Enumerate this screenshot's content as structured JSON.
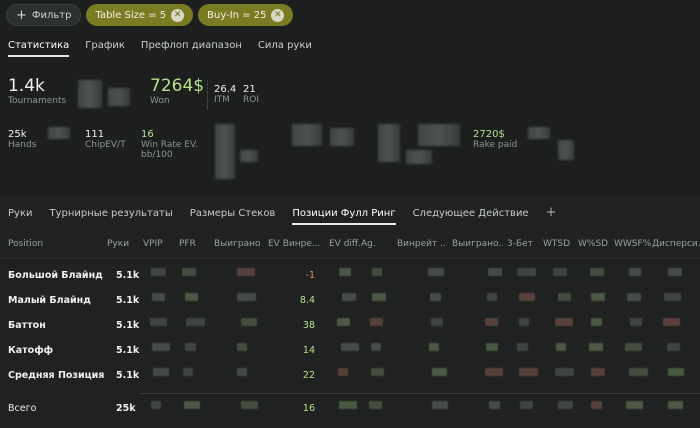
{
  "filters": {
    "filter_label": "Фильтр",
    "chips": [
      {
        "label": "Table Size = 5"
      },
      {
        "label": "Buy-In = 25"
      }
    ]
  },
  "main_tabs": [
    "Статистика",
    "График",
    "Префлоп диапазон",
    "Сила руки"
  ],
  "stats": {
    "tournaments": {
      "value": "1.4k",
      "label": "Tournaments"
    },
    "won": {
      "value": "7264$",
      "label": "Won"
    },
    "itm": {
      "value": "26.4",
      "label": "ITM"
    },
    "roi": {
      "value": "21",
      "label": "ROI"
    },
    "hands": {
      "value": "25k",
      "label": "Hands"
    },
    "chipev": {
      "value": "111",
      "label": "ChipEV/T"
    },
    "winrate": {
      "value": "16",
      "label": "Win Rate EV.",
      "label2": "bb/100"
    },
    "rake": {
      "value": "2720$",
      "label": "Rake paid"
    }
  },
  "sub_tabs": [
    "Руки",
    "Турнирные результаты",
    "Размеры Стеков",
    "Позиции Фулл Ринг",
    "Следующее Действие"
  ],
  "table": {
    "headers": [
      "Position",
      "Руки",
      "VPIP",
      "PFR",
      "Выиграно",
      "EV Винре...",
      "EV diff.",
      "Ag.",
      "Винрейт ...",
      "Выиграно...",
      "3-Бет",
      "WTSD",
      "W%SD",
      "WWSF%",
      "Дисперси..."
    ],
    "rows": [
      {
        "position": "Большой Блайнд",
        "hands": "5.1k",
        "ev": "-1"
      },
      {
        "position": "Малый Блайнд",
        "hands": "5.1k",
        "ev": "8.4"
      },
      {
        "position": "Баттон",
        "hands": "5.1k",
        "ev": "38"
      },
      {
        "position": "Катофф",
        "hands": "5.1k",
        "ev": "14"
      },
      {
        "position": "Средняя Позиция",
        "hands": "5.1k",
        "ev": "22"
      }
    ],
    "total": {
      "position": "Всего",
      "hands": "25k",
      "ev": "16"
    }
  },
  "colors": {
    "accent_green": "#b6e08a",
    "negative": "#e58a6a",
    "chip": "#7a7b22"
  }
}
